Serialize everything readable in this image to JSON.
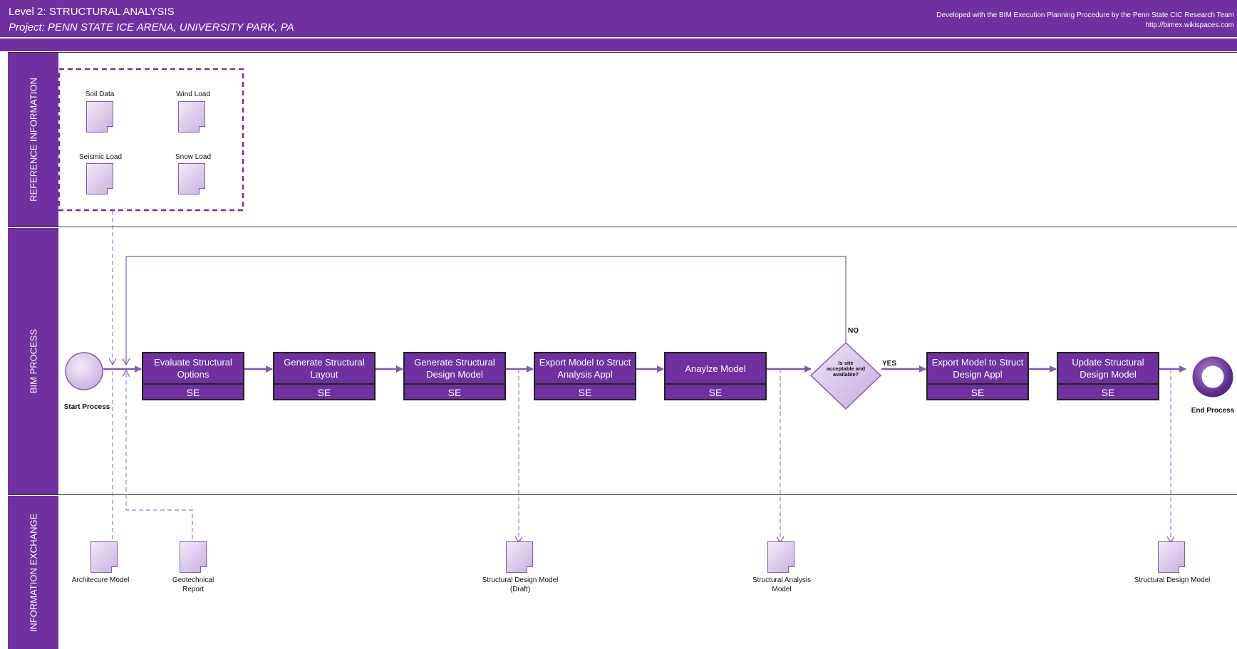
{
  "header": {
    "title": "Level 2: STRUCTURAL ANALYSIS",
    "project": "Project: PENN STATE ICE ARENA, UNIVERSITY PARK, PA",
    "credit_line1": "Developed with the BIM Execution Planning Procedure by the Penn State CIC Research Team",
    "credit_line2": "http://bimex.wikispaces.com"
  },
  "lanes": {
    "reference": "REFERENCE INFORMATION",
    "process": "BIM PROCESS",
    "exchange": "INFORMATION EXCHANGE"
  },
  "reference_docs": [
    {
      "label": "Soil Data"
    },
    {
      "label": "Wind Load"
    },
    {
      "label": "Seismic Load"
    },
    {
      "label": "Snow Load"
    }
  ],
  "start": {
    "label": "Start Process"
  },
  "end": {
    "label": "End Process"
  },
  "tasks": [
    {
      "name": "Evaluate Structural Options",
      "role": "SE"
    },
    {
      "name": "Generate Structural Layout",
      "role": "SE"
    },
    {
      "name": "Generate Structural Design Model",
      "role": "SE"
    },
    {
      "name": "Export Model to Struct Analysis Appl",
      "role": "SE"
    },
    {
      "name": "Anaylze Model",
      "role": "SE"
    },
    {
      "name": "Export Model to Struct Design Appl",
      "role": "SE"
    },
    {
      "name": "Update Structural Design Model",
      "role": "SE"
    }
  ],
  "decision": {
    "question": "Is site acceptable and available?",
    "yes_label": "YES",
    "no_label": "NO"
  },
  "exchange_docs": [
    {
      "label": "Architecure Model"
    },
    {
      "label": "Geotechnical Report"
    },
    {
      "label": "Structural Design Model (Draft)"
    },
    {
      "label": "Structural Analysis Model"
    },
    {
      "label": "Structural Design Model"
    }
  ],
  "colors": {
    "primary": "#7030a0",
    "connector": "#7e5ea8",
    "doc_fill": "#d9c6eb"
  }
}
